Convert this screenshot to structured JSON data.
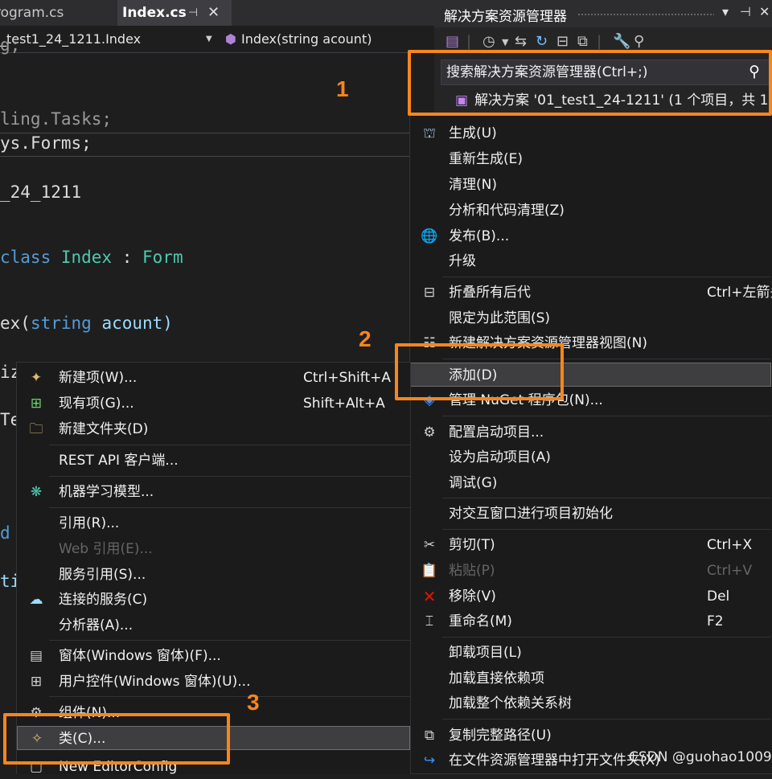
{
  "editor": {
    "tabs": [
      {
        "label": "rogram.cs"
      },
      {
        "label": "Index.cs"
      }
    ],
    "tab_pin": "⊣",
    "tab_close": "✕",
    "nav_class": "_test1_24_1211.Index",
    "nav_member": "Index(string acount)",
    "code": {
      "l1": "g;",
      "l2a": "ling.",
      "l2b": "Tasks;",
      "l3a": "ys.",
      "l3b": "Forms;",
      "l4": "_24_1211",
      "l5a": "class ",
      "l5b": "Index",
      "l5c": " : ",
      "l5d": "Form",
      "l6a": "ex(",
      "l6b": "string ",
      "l6c": "acount)",
      "l7": "iz",
      "l8": "Te",
      "l9": "d",
      "l10": "ti"
    }
  },
  "solution_explorer": {
    "title": "解决方案资源管理器",
    "title_controls": {
      "dropdown": "▾",
      "pin": "⊣",
      "close": "✕"
    },
    "search_placeholder": "搜索解决方案资源管理器(Ctrl+;)",
    "root_label": "解决方案 '01_test1_24-1211' (1 个项目，共 1"
  },
  "context_menu_right": {
    "items": [
      {
        "label": "生成(U)",
        "shortcut": "",
        "icon": "build-icon",
        "disabled": false
      },
      {
        "label": "重新生成(E)",
        "shortcut": "",
        "icon": "",
        "disabled": false
      },
      {
        "label": "清理(N)",
        "shortcut": "",
        "icon": "",
        "disabled": false
      },
      {
        "label": "分析和代码清理(Z)",
        "shortcut": "",
        "icon": "",
        "disabled": false
      },
      {
        "label": "发布(B)...",
        "shortcut": "",
        "icon": "globe-icon",
        "disabled": false
      },
      {
        "label": "升级",
        "shortcut": "",
        "icon": "",
        "disabled": false
      },
      {
        "label": "折叠所有后代",
        "shortcut": "Ctrl+左箭头",
        "icon": "collapse-icon",
        "disabled": false
      },
      {
        "label": "限定为此范围(S)",
        "shortcut": "",
        "icon": "",
        "disabled": false
      },
      {
        "label": "新建解决方案资源管理器视图(N)",
        "shortcut": "",
        "icon": "new-view-icon",
        "disabled": false
      },
      {
        "label": "添加(D)",
        "shortcut": "",
        "icon": "",
        "disabled": false
      },
      {
        "label": "管理 NuGet 程序包(N)...",
        "shortcut": "",
        "icon": "nuget-icon",
        "disabled": false
      },
      {
        "label": "配置启动项目...",
        "shortcut": "",
        "icon": "gear-icon",
        "disabled": false
      },
      {
        "label": "设为启动项目(A)",
        "shortcut": "",
        "icon": "",
        "disabled": false
      },
      {
        "label": "调试(G)",
        "shortcut": "",
        "icon": "",
        "disabled": false
      },
      {
        "label": "对交互窗口进行项目初始化",
        "shortcut": "",
        "icon": "",
        "disabled": false
      },
      {
        "label": "剪切(T)",
        "shortcut": "Ctrl+X",
        "icon": "scissors-icon",
        "disabled": false
      },
      {
        "label": "粘贴(P)",
        "shortcut": "Ctrl+V",
        "icon": "paste-icon",
        "disabled": true
      },
      {
        "label": "移除(V)",
        "shortcut": "Del",
        "icon": "remove-icon",
        "disabled": false
      },
      {
        "label": "重命名(M)",
        "shortcut": "F2",
        "icon": "rename-icon",
        "disabled": false
      },
      {
        "label": "卸载项目(L)",
        "shortcut": "",
        "icon": "",
        "disabled": false
      },
      {
        "label": "加载直接依赖项",
        "shortcut": "",
        "icon": "",
        "disabled": false
      },
      {
        "label": "加载整个依赖关系树",
        "shortcut": "",
        "icon": "",
        "disabled": false
      },
      {
        "label": "复制完整路径(U)",
        "shortcut": "",
        "icon": "copy-icon",
        "disabled": false
      },
      {
        "label": "在文件资源管理器中打开文件夹(X)",
        "shortcut": "",
        "icon": "open-folder-icon",
        "disabled": false
      }
    ]
  },
  "context_menu_add": {
    "items": [
      {
        "label": "新建项(W)...",
        "shortcut": "Ctrl+Shift+A",
        "icon": "new-item-icon",
        "disabled": false
      },
      {
        "label": "现有项(G)...",
        "shortcut": "Shift+Alt+A",
        "icon": "existing-item-icon",
        "disabled": false
      },
      {
        "label": "新建文件夹(D)",
        "shortcut": "",
        "icon": "new-folder-icon",
        "disabled": false
      },
      {
        "label": "REST API 客户端...",
        "shortcut": "",
        "icon": "",
        "disabled": false
      },
      {
        "label": "机器学习模型...",
        "shortcut": "",
        "icon": "ml-model-icon",
        "disabled": false
      },
      {
        "label": "引用(R)...",
        "shortcut": "",
        "icon": "",
        "disabled": false
      },
      {
        "label": "Web 引用(E)...",
        "shortcut": "",
        "icon": "",
        "disabled": true
      },
      {
        "label": "服务引用(S)...",
        "shortcut": "",
        "icon": "",
        "disabled": false
      },
      {
        "label": "连接的服务(C)",
        "shortcut": "",
        "icon": "connected-service-icon",
        "disabled": false
      },
      {
        "label": "分析器(A)...",
        "shortcut": "",
        "icon": "",
        "disabled": false
      },
      {
        "label": "窗体(Windows 窗体)(F)...",
        "shortcut": "",
        "icon": "form-icon",
        "disabled": false
      },
      {
        "label": "用户控件(Windows 窗体)(U)...",
        "shortcut": "",
        "icon": "user-control-icon",
        "disabled": false
      },
      {
        "label": "组件(N)...",
        "shortcut": "",
        "icon": "component-icon",
        "disabled": false
      },
      {
        "label": "类(C)...",
        "shortcut": "",
        "icon": "class-icon",
        "disabled": false
      },
      {
        "label": "New EditorConfig",
        "shortcut": "",
        "icon": "editorconfig-icon",
        "disabled": false
      }
    ]
  },
  "annotations": {
    "n1": "1",
    "n2": "2",
    "n3": "3"
  },
  "watermark": "CSDN @guohao1009",
  "colors": {
    "accent_orange": "#f7861c",
    "keyword": "#569cd6",
    "type": "#4ec9b0",
    "param": "#9cdcfe",
    "menu_bg": "#1b1b1c"
  }
}
